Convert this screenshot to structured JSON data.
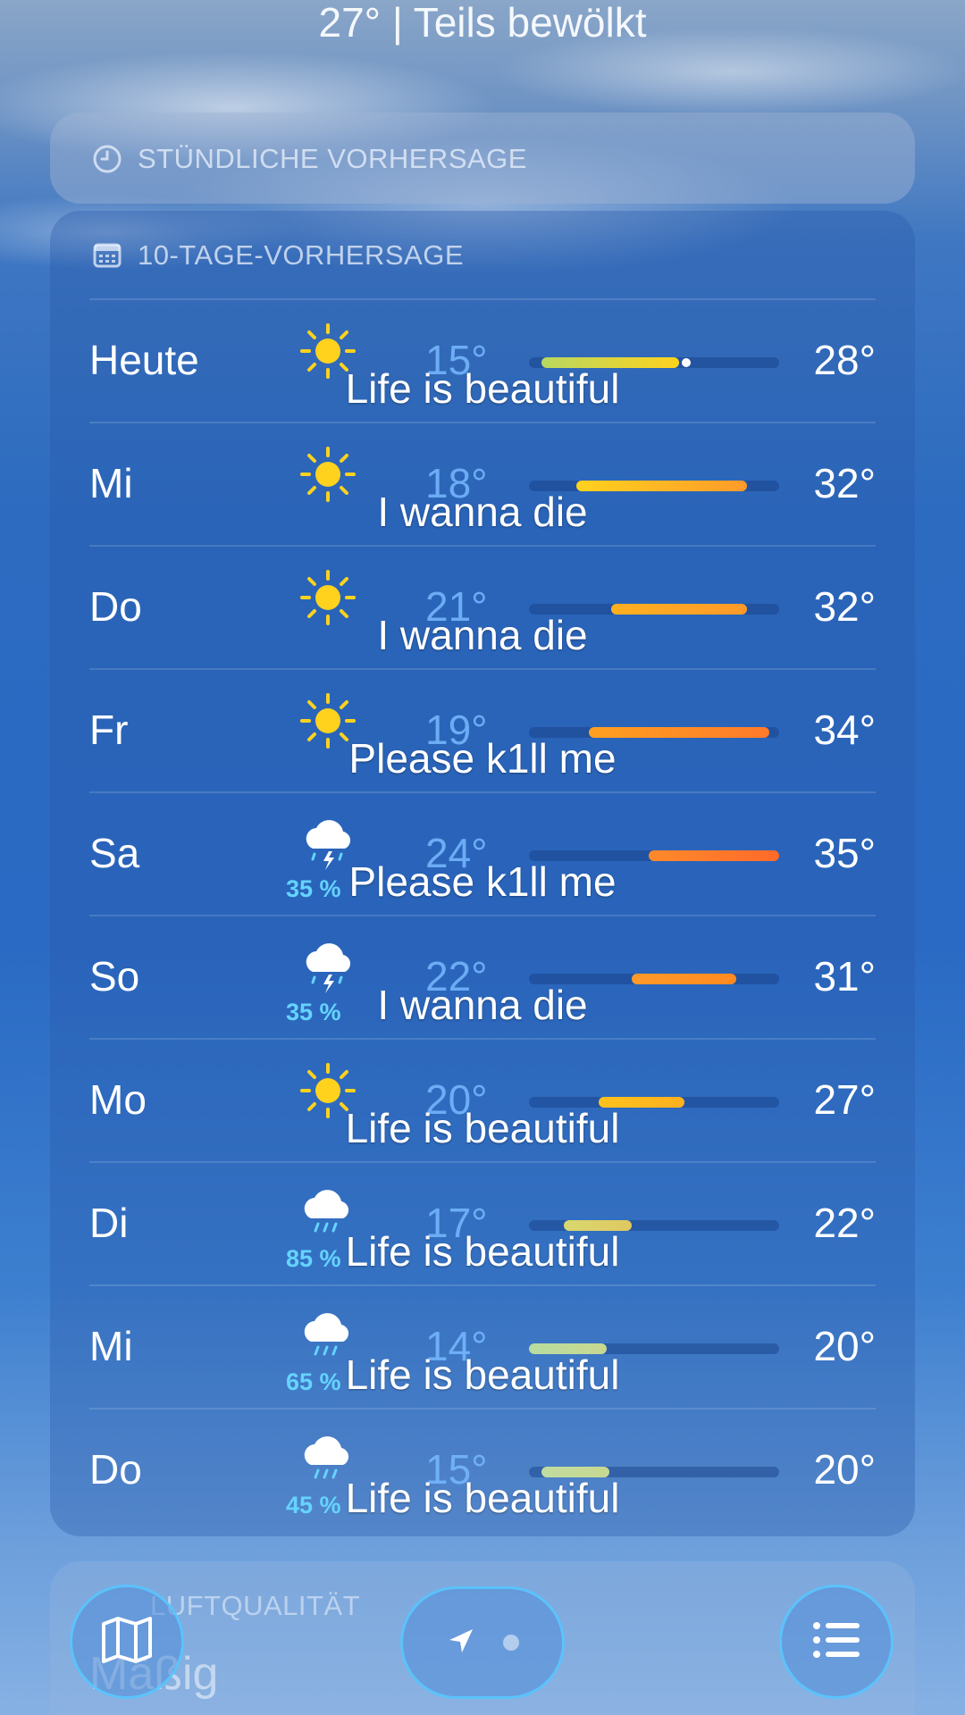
{
  "current": {
    "summary": "27°  |  Teils bewölkt"
  },
  "hourly": {
    "title": "STÜNDLICHE VORHERSAGE"
  },
  "daily": {
    "title": "10-TAGE-VORHERSAGE",
    "days": [
      {
        "day": "Heute",
        "icon": "sun-icon",
        "precip": "",
        "low": "15°",
        "high": "28°",
        "range": [
          0.05,
          0.6
        ],
        "color": [
          "#b8d860",
          "#ffd21e"
        ],
        "current_marker": 0.63,
        "caption": "Life is beautiful"
      },
      {
        "day": "Mi",
        "icon": "sun-icon",
        "precip": "",
        "low": "18°",
        "high": "32°",
        "range": [
          0.19,
          0.87
        ],
        "color": [
          "#ffd21e",
          "#ff9a2a"
        ],
        "caption": "I wanna die"
      },
      {
        "day": "Do",
        "icon": "sun-icon",
        "precip": "",
        "low": "21°",
        "high": "32°",
        "range": [
          0.33,
          0.87
        ],
        "color": [
          "#ffb020",
          "#ff9a2a"
        ],
        "caption": "I wanna die"
      },
      {
        "day": "Fr",
        "icon": "sun-icon",
        "precip": "",
        "low": "19°",
        "high": "34°",
        "range": [
          0.24,
          0.96
        ],
        "color": [
          "#ffa020",
          "#ff7a2a"
        ],
        "caption": "Please k1ll me"
      },
      {
        "day": "Sa",
        "icon": "thunderstorm-icon",
        "precip": "35 %",
        "low": "24°",
        "high": "35°",
        "range": [
          0.48,
          1.0
        ],
        "color": [
          "#ff8a2a",
          "#ff6a2a"
        ],
        "caption": "Please k1ll me"
      },
      {
        "day": "So",
        "icon": "thunderstorm-icon",
        "precip": "35 %",
        "low": "22°",
        "high": "31°",
        "range": [
          0.41,
          0.83
        ],
        "color": [
          "#ff9a2a",
          "#ff8a20"
        ],
        "caption": "I wanna die"
      },
      {
        "day": "Mo",
        "icon": "sun-icon",
        "precip": "",
        "low": "20°",
        "high": "27°",
        "range": [
          0.28,
          0.62
        ],
        "color": [
          "#ffc21e",
          "#ffb020"
        ],
        "caption": "Life is beautiful"
      },
      {
        "day": "Di",
        "icon": "rain-cloud-icon",
        "precip": "85 %",
        "low": "17°",
        "high": "22°",
        "range": [
          0.14,
          0.41
        ],
        "color": [
          "#d8d870",
          "#e0c860"
        ],
        "caption": "Life is beautiful"
      },
      {
        "day": "Mi",
        "icon": "rain-cloud-icon",
        "precip": "65 %",
        "low": "14°",
        "high": "20°",
        "range": [
          0.0,
          0.31
        ],
        "color": [
          "#b8dca0",
          "#c8d890"
        ],
        "caption": "Life is beautiful"
      },
      {
        "day": "Do",
        "icon": "rain-cloud-icon",
        "precip": "45 %",
        "low": "15°",
        "high": "20°",
        "range": [
          0.05,
          0.32
        ],
        "color": [
          "#c0dca0",
          "#c8d890"
        ],
        "caption": "Life is beautiful"
      }
    ]
  },
  "air_quality": {
    "title": "LUFTQUALITÄT",
    "value": "Mäßig"
  },
  "toolbar": {
    "map_icon": "map-icon",
    "location_icon": "location-arrow-icon",
    "list_icon": "list-icon"
  }
}
